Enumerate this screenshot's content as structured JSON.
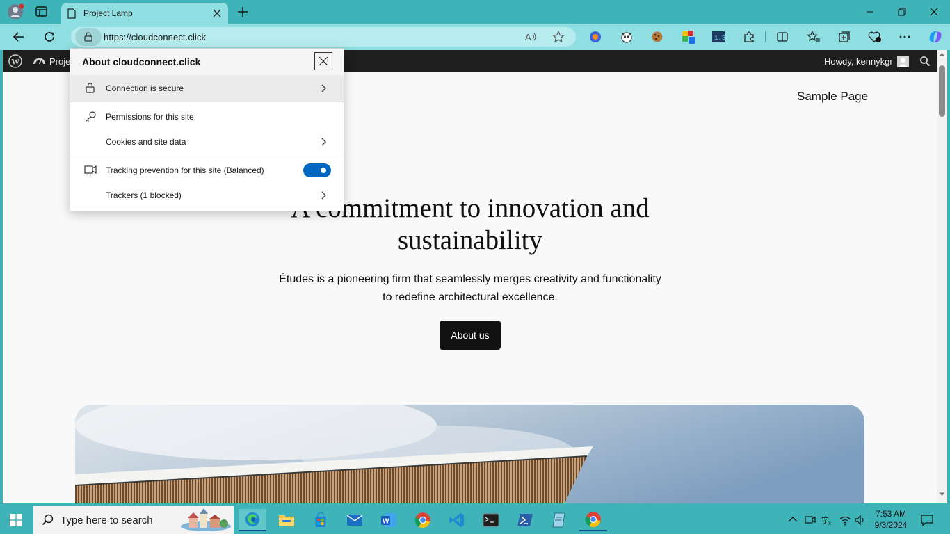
{
  "browser": {
    "tab_title": "Project Lamp",
    "url": "https://cloudconnect.click"
  },
  "wp_admin_bar": {
    "site_label_partial": "Proje",
    "howdy": "Howdy, kennykgr"
  },
  "page": {
    "nav_link": "Sample Page",
    "hero_title_line1": "A commitment to innovation and",
    "hero_title_line2": "sustainability",
    "hero_sub_line1": "Études is a pioneering firm that seamlessly merges creativity and functionality",
    "hero_sub_line2": "to redefine architectural excellence.",
    "cta_label": "About us"
  },
  "site_info_popup": {
    "title": "About cloudconnect.click",
    "rows": {
      "connection": "Connection is secure",
      "permissions": "Permissions for this site",
      "cookies": "Cookies and site data",
      "tracking": "Tracking prevention for this site (Balanced)",
      "trackers": "Trackers (1 blocked)"
    },
    "tracking_enabled": true
  },
  "taskbar": {
    "search_placeholder": "Type here to search",
    "time": "7:53 AM",
    "date": "9/3/2024"
  },
  "colors": {
    "accent": "#0067c0",
    "frame": "#3fb4b8",
    "toolbar": "#8fdfe2",
    "wp_bar": "#1e1e1e"
  }
}
